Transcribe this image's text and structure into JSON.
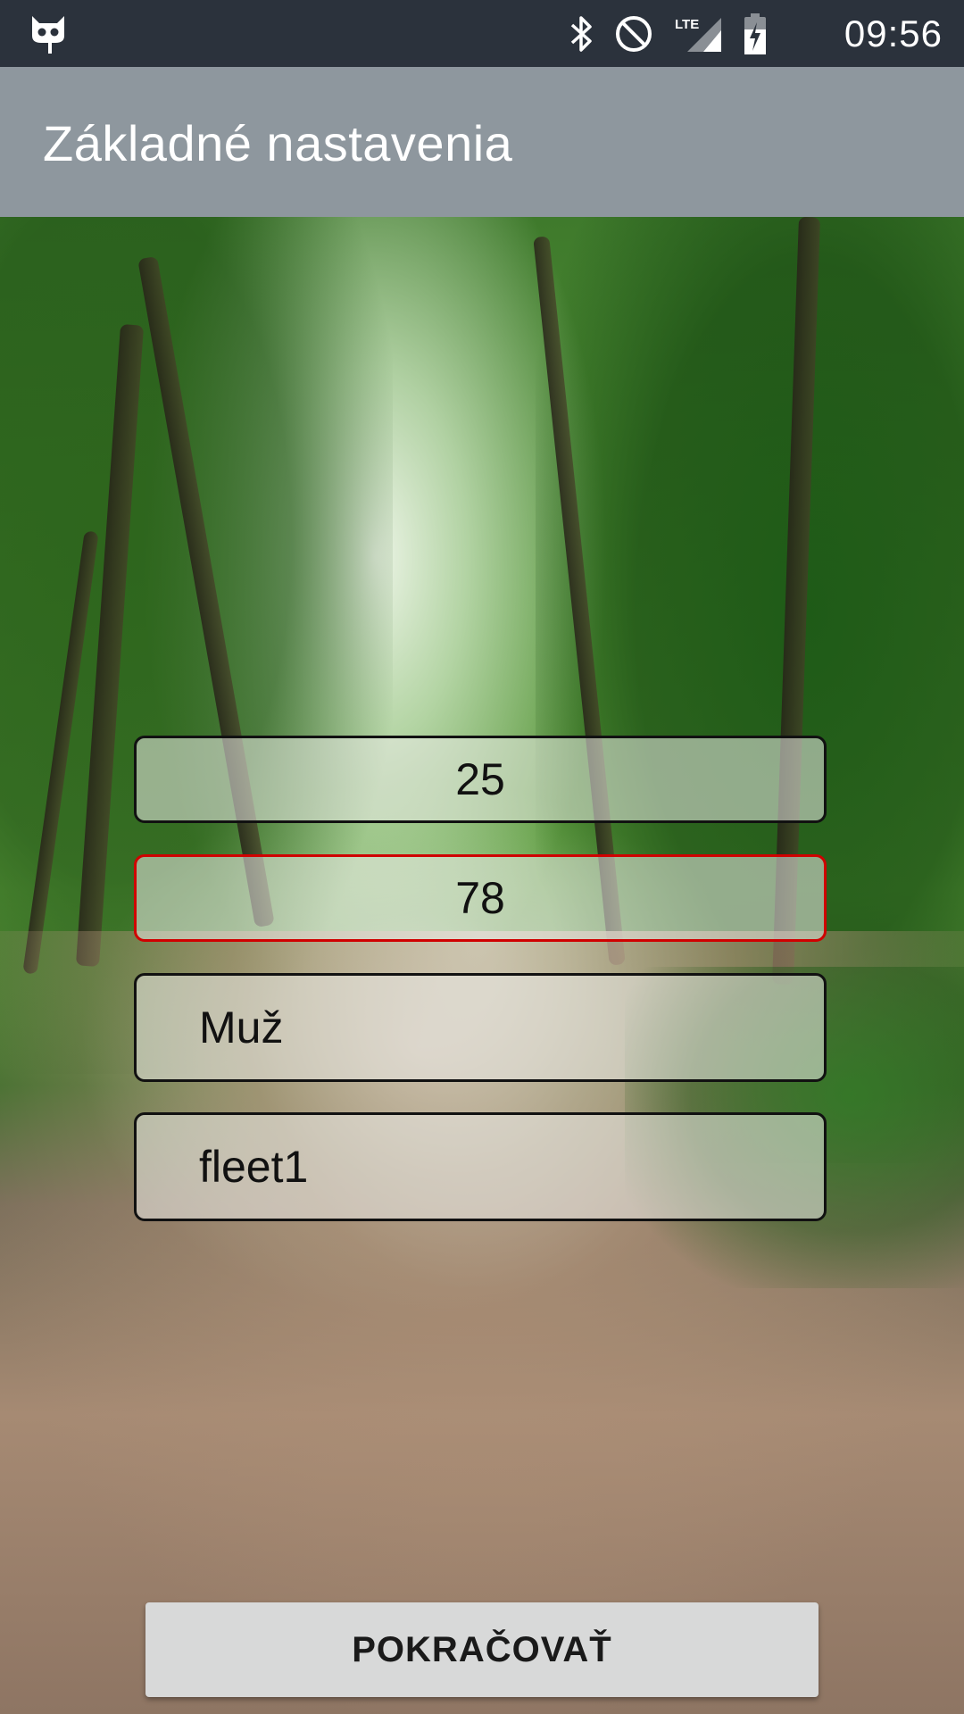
{
  "status_bar": {
    "time": "09:56",
    "icons": [
      "cyanogen-cat-icon",
      "bluetooth-icon",
      "do-not-disturb-icon",
      "lte-signal-icon",
      "battery-charging-icon"
    ]
  },
  "toolbar": {
    "title": "Základné nastavenia"
  },
  "form": {
    "age_value": "25",
    "weight_value": "78",
    "gender_value": "Muž",
    "fleet_value": "fleet1",
    "error_border_color": "#d00000"
  },
  "actions": {
    "continue_label": "POKRAČOVAŤ"
  }
}
